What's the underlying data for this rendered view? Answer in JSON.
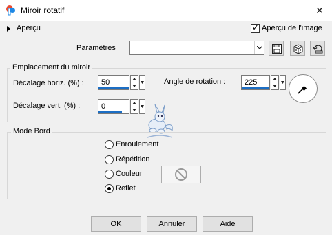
{
  "window": {
    "title": "Miroir rotatif",
    "close_glyph": "✕"
  },
  "preview": {
    "expander_label": "Aperçu",
    "checkbox_label": "Aperçu de l'image",
    "checkbox_checked": true
  },
  "params": {
    "label": "Paramètres",
    "preset_value": "",
    "tools": [
      "save-icon",
      "randomize-dice-icon",
      "reset-icon"
    ]
  },
  "mirror_group": {
    "title": "Emplacement du miroir",
    "horiz_label": "Décalage horiz. (%) :",
    "horiz_value": "50",
    "vert_label": "Décalage vert. (%) :",
    "vert_value": "0",
    "angle_label": "Angle de rotation :",
    "angle_value": "225"
  },
  "edge_group": {
    "title": "Mode Bord",
    "options": [
      "Enroulement",
      "Répétition",
      "Couleur",
      "Reflet"
    ],
    "selected": "Reflet"
  },
  "buttons": {
    "ok": "OK",
    "cancel": "Annuler",
    "help": "Aide"
  },
  "colors": {
    "accent": "#1c6ec4",
    "background": "#f0f0f0"
  }
}
